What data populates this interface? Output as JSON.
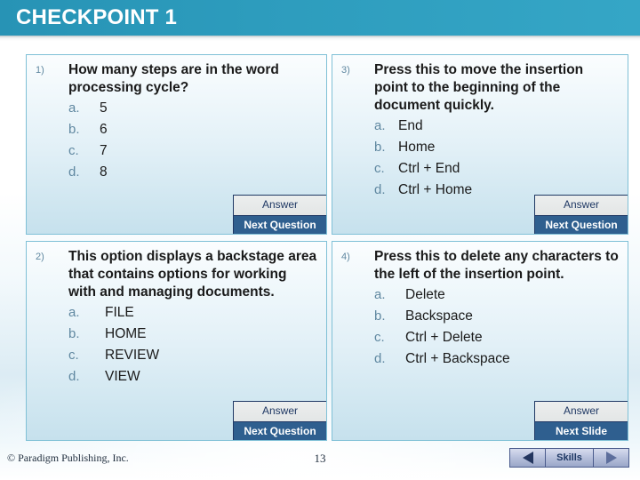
{
  "header": {
    "title": "CHECKPOINT 1",
    "accent_color": "#2d9cbd"
  },
  "questions": [
    {
      "number": "1)",
      "text": "How many steps are in the word processing cycle?",
      "options": [
        {
          "letter": "a.",
          "text": "5"
        },
        {
          "letter": "b.",
          "text": "6"
        },
        {
          "letter": "c.",
          "text": "7"
        },
        {
          "letter": "d.",
          "text": "8"
        }
      ],
      "answer_label": "Answer",
      "next_label": "Next Question"
    },
    {
      "number": "3)",
      "text": "Press this to move the insertion point to the beginning of the document quickly.",
      "options": [
        {
          "letter": "a.",
          "text": "End"
        },
        {
          "letter": "b.",
          "text": "Home"
        },
        {
          "letter": "c.",
          "text": "Ctrl + End"
        },
        {
          "letter": "d.",
          "text": "Ctrl + Home"
        }
      ],
      "answer_label": "Answer",
      "next_label": "Next Question"
    },
    {
      "number": "2)",
      "text": "This option displays a backstage area that contains options for working with and managing documents.",
      "options": [
        {
          "letter": "a.",
          "text": "FILE"
        },
        {
          "letter": "b.",
          "text": "HOME"
        },
        {
          "letter": "c.",
          "text": "REVIEW"
        },
        {
          "letter": "d.",
          "text": "VIEW"
        }
      ],
      "answer_label": "Answer",
      "next_label": "Next Question"
    },
    {
      "number": "4)",
      "text": "Press this to delete any characters to the left of the insertion point.",
      "options": [
        {
          "letter": "a.",
          "text": "Delete"
        },
        {
          "letter": "b.",
          "text": "Backspace"
        },
        {
          "letter": "c.",
          "text": "Ctrl + Delete"
        },
        {
          "letter": "d.",
          "text": "Ctrl + Backspace"
        }
      ],
      "answer_label": "Answer",
      "next_label": "Next Slide"
    }
  ],
  "footer": {
    "copyright": "© Paradigm Publishing, Inc.",
    "page_number": "13",
    "nav": {
      "prev_icon": "triangle-left-icon",
      "skills_label": "Skills",
      "next_icon": "triangle-right-icon"
    }
  }
}
